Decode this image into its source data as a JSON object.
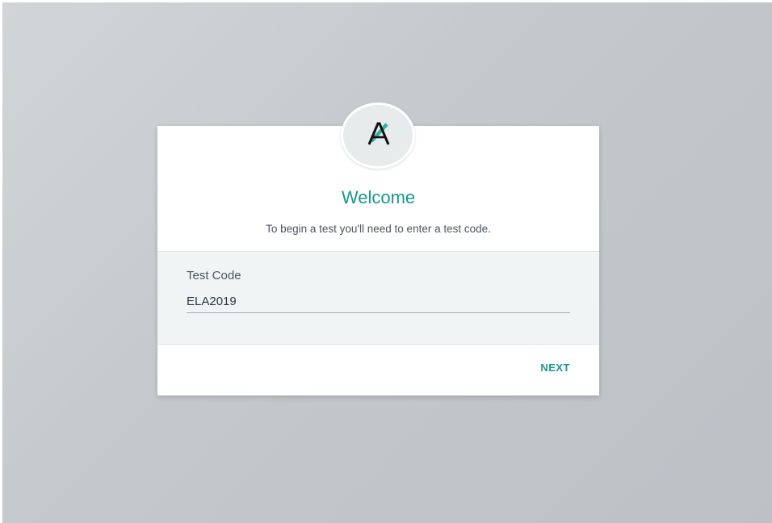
{
  "dialog": {
    "logo_icon": "ampersand-a-logo-icon",
    "title": "Welcome",
    "subtitle": "To begin a test you'll need to enter a test code.",
    "field": {
      "label": "Test Code",
      "value": "ELA2019"
    },
    "next_label": "NEXT"
  },
  "colors": {
    "accent": "#16998a",
    "background": "#c4c8cc",
    "panel": "#f1f4f5"
  }
}
